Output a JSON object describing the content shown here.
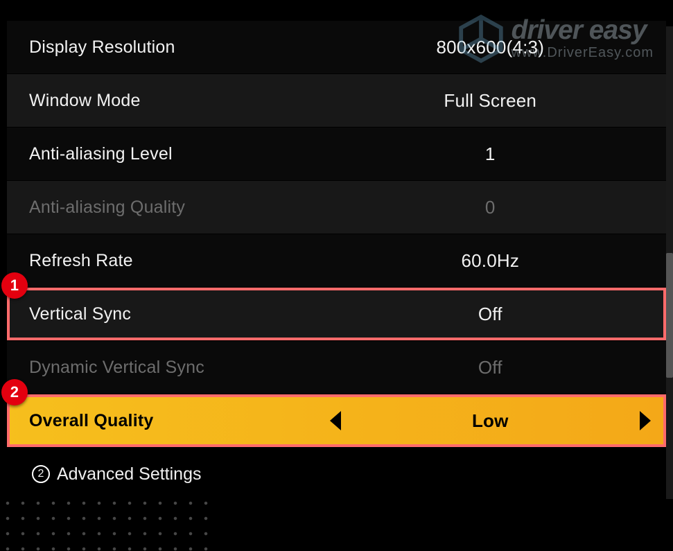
{
  "watermark": {
    "title": "driver easy",
    "url": "www.DriverEasy.com"
  },
  "settings": {
    "display_resolution": {
      "label": "Display Resolution",
      "value": "800x600(4:3)"
    },
    "window_mode": {
      "label": "Window Mode",
      "value": "Full Screen"
    },
    "anti_aliasing_level": {
      "label": "Anti-aliasing Level",
      "value": "1"
    },
    "anti_aliasing_quality": {
      "label": "Anti-aliasing Quality",
      "value": "0"
    },
    "refresh_rate": {
      "label": "Refresh Rate",
      "value": "60.0Hz"
    },
    "vertical_sync": {
      "label": "Vertical Sync",
      "value": "Off"
    },
    "dynamic_vsync": {
      "label": "Dynamic Vertical Sync",
      "value": "Off"
    },
    "overall_quality": {
      "label": "Overall Quality",
      "value": "Low"
    }
  },
  "advanced": {
    "label": "Advanced Settings",
    "num": "2"
  },
  "callouts": {
    "one": "1",
    "two": "2"
  }
}
